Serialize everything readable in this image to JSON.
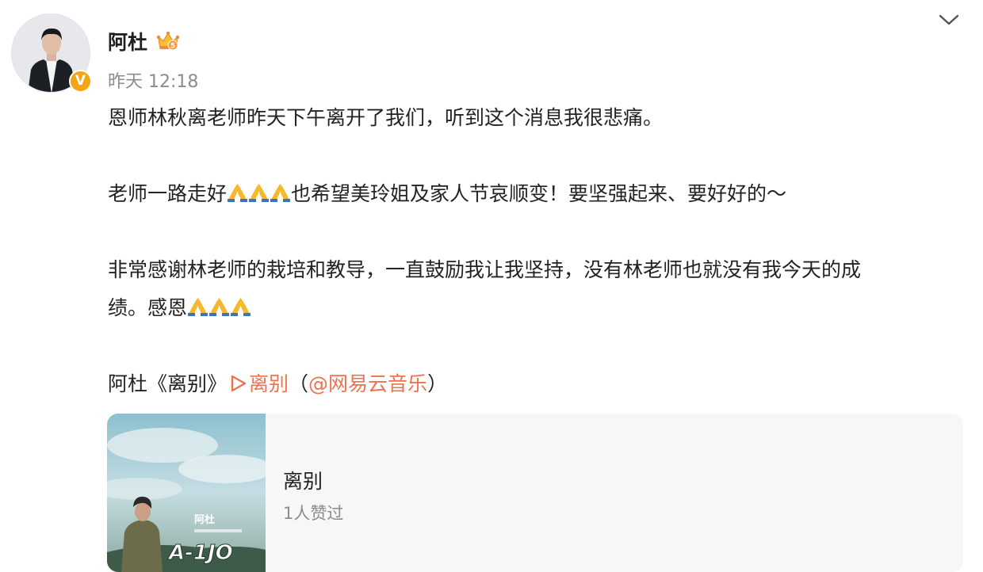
{
  "post": {
    "author": "阿杜",
    "time": "昨天 12:18",
    "verified_badge": "V",
    "crown_level": "5",
    "line1": "恩师林秋离老师昨天下午离开了我们，听到这个消息我很悲痛。",
    "line2_a": "老师一路走好",
    "line2_b": "也希望美玲姐及家人节哀顺变！要坚强起来、要好好的～",
    "line3": "非常感谢林老师的栽培和教导，一直鼓励我让我坚持，没有林老师也就没有我今天的成",
    "line4": "绩。感恩",
    "song_prefix": "阿杜《离别》",
    "song_link": "离别",
    "paren_open": "（",
    "mention": "@网易云音乐",
    "paren_close": "）"
  },
  "music_card": {
    "title": "离别",
    "likes": "1人赞过",
    "cover_text": "A-1JO",
    "cover_artist": "阿杜"
  },
  "icons": {
    "pray": "folded-hands-icon",
    "crown": "crown-icon",
    "chevron": "chevron-down-icon",
    "play": "play-icon"
  },
  "colors": {
    "link": "#eb7350",
    "badge": "#f3a613",
    "meta_text": "#8c8c8c"
  }
}
